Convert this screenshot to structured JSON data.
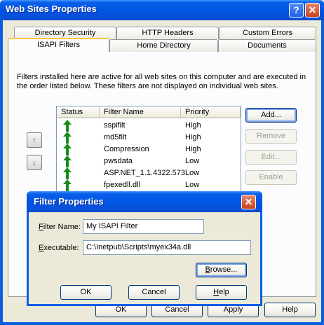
{
  "window": {
    "title": "Web Sites Properties",
    "help_glyph": "?",
    "close_glyph": "✕"
  },
  "tabs": {
    "row_back": [
      "Directory Security",
      "HTTP Headers",
      "Custom Errors"
    ],
    "row_front": [
      "ISAPI Filters",
      "Home Directory",
      "Documents"
    ],
    "active": "ISAPI Filters"
  },
  "description": "Filters installed here are active for all web sites on this computer and are executed in the order listed below.  These filters are not displayed on individual web sites.",
  "filters": {
    "columns": [
      "Status",
      "Filter Name",
      "Priority"
    ],
    "rows": [
      {
        "name": "sspifilt",
        "priority": "High"
      },
      {
        "name": "md5filt",
        "priority": "High"
      },
      {
        "name": "Compression",
        "priority": "High"
      },
      {
        "name": "pwsdata",
        "priority": "Low"
      },
      {
        "name": "ASP.NET_1.1.4322.573",
        "priority": "Low"
      },
      {
        "name": "fpexedll.dll",
        "priority": "Low"
      }
    ],
    "status_icon": "green-up-arrow-icon",
    "status_color": "#1c8a1c"
  },
  "side_buttons": {
    "up_glyph": "↑",
    "down_glyph": "↓"
  },
  "right_buttons": {
    "add": "Add...",
    "remove": "Remove",
    "edit": "Edit...",
    "enable": "Enable"
  },
  "bottom_buttons": {
    "ok": "OK",
    "cancel": "Cancel",
    "apply": "Apply",
    "help": "Help"
  },
  "dialog": {
    "title": "Filter Properties",
    "filter_name_label": "Filter Name:",
    "filter_name_value": "My ISAPI Filter",
    "executable_label": "Executable:",
    "executable_value": "C:\\Inetpub\\Scripts\\myex34a.dll",
    "browse": "Browse...",
    "ok": "OK",
    "cancel": "Cancel",
    "help": "Help"
  },
  "colors": {
    "title_blue": "#0054e3",
    "tab_highlight": "#ffc83c",
    "face": "#ece9d8"
  }
}
